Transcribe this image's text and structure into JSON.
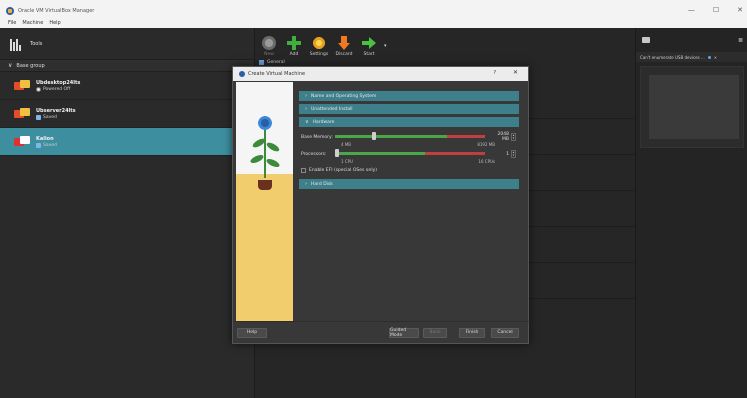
{
  "window": {
    "title": "Oracle VM VirtualBox Manager",
    "controls": [
      "—",
      "☐",
      "✕"
    ]
  },
  "menubar": [
    "File",
    "Machine",
    "Help"
  ],
  "sidebar": {
    "tools_label": "Tools",
    "group_label": "Base group",
    "vms": [
      {
        "name": "Ubdesktop24lts",
        "state": "Powered Off",
        "state_kind": "off"
      },
      {
        "name": "Ubserver24lts",
        "state": "Saved",
        "state_kind": "saved"
      },
      {
        "name": "Kalion",
        "state": "Saved",
        "state_kind": "saved"
      }
    ]
  },
  "toolbar": {
    "new_label": "New",
    "add_label": "Add",
    "settings_label": "Settings",
    "discard_label": "Discard",
    "start_label": "Start"
  },
  "detail": {
    "general_label": "General"
  },
  "right_panel": {
    "notice": "Can't enumerate USB devices ..."
  },
  "dialog": {
    "title": "Create Virtual Machine",
    "help_glyph": "?",
    "close_glyph": "✕",
    "sections": {
      "name_os": "Name and Operating System",
      "unattended": "Unattended Install",
      "hardware": "Hardware",
      "hard_disk": "Hard Disk"
    },
    "hardware": {
      "memory_label": "Base Memory:",
      "memory_value": "2048 MB",
      "memory_min": "4 MB",
      "memory_max": "8192 MB",
      "memory_fraction": 0.25,
      "processors_label": "Processors:",
      "processors_value": "1",
      "processors_min": "1 CPU",
      "processors_max": "16 CPUs",
      "processors_fraction": 0.0,
      "efi_label": "Enable EFI (special OSes only)"
    },
    "buttons": {
      "help": "Help",
      "guided": "Guided Mode",
      "back": "Back",
      "finish": "Finish",
      "cancel": "Cancel"
    }
  },
  "colors": {
    "accent": "#3e7f8c",
    "selected": "#3d8fa0",
    "art_background": "#f2cd6e"
  }
}
